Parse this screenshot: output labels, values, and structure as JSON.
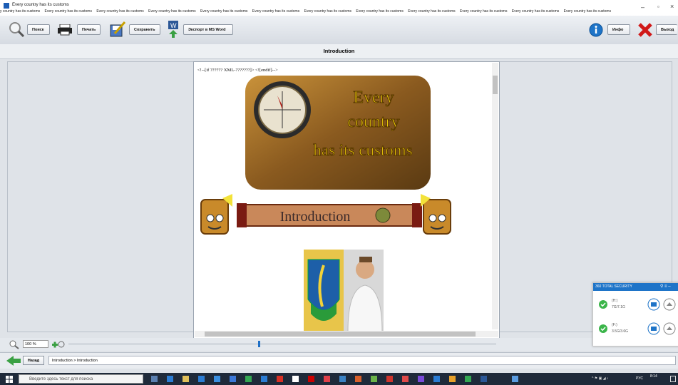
{
  "window": {
    "title": "Every country has its customs",
    "tab_strip": [
      "y country has its customs",
      "Every country has its customs",
      "Every country has its customs",
      "Every country has its customs",
      "Every country has its customs",
      "Every country has its customs",
      "Every country has its customs",
      "Every country has its customs",
      "Every country has its customs",
      "Every country has its customs",
      "Every country has its customs",
      "Every country has its customs"
    ]
  },
  "toolbar": {
    "search_label": "Поиск",
    "print_label": "Печать",
    "save_label": "Сохранить",
    "export_label": "Экспорт в MS Word",
    "info_label": "Инфо",
    "exit_label": "Выход"
  },
  "header": {
    "title": "Introduction"
  },
  "document": {
    "xml_comment": "<!--[if ?????? XML-???????]>  <![endif]-->",
    "cover_lines": [
      "Every",
      "country",
      "has its customs"
    ],
    "banner_text": "Introduction"
  },
  "zoom": {
    "value": "100 %"
  },
  "nav": {
    "back_label": "Назад",
    "breadcrumb": "Introduction > Introduction"
  },
  "taskbar": {
    "search_placeholder": "Введите здесь текст для поиска",
    "lang": "РУС",
    "time": "8:14"
  },
  "security_widget": {
    "title": "360 TOTAL SECURITY",
    "drives": [
      {
        "label": "(H:)",
        "size": "7G/7.1G"
      },
      {
        "label": "(F:)",
        "size": "3.5G/3.6G"
      }
    ]
  },
  "colors": {
    "accent": "#1e74c8",
    "toolbar_bg": "#dfe3e8",
    "taskbar": "#1f2a3a"
  }
}
